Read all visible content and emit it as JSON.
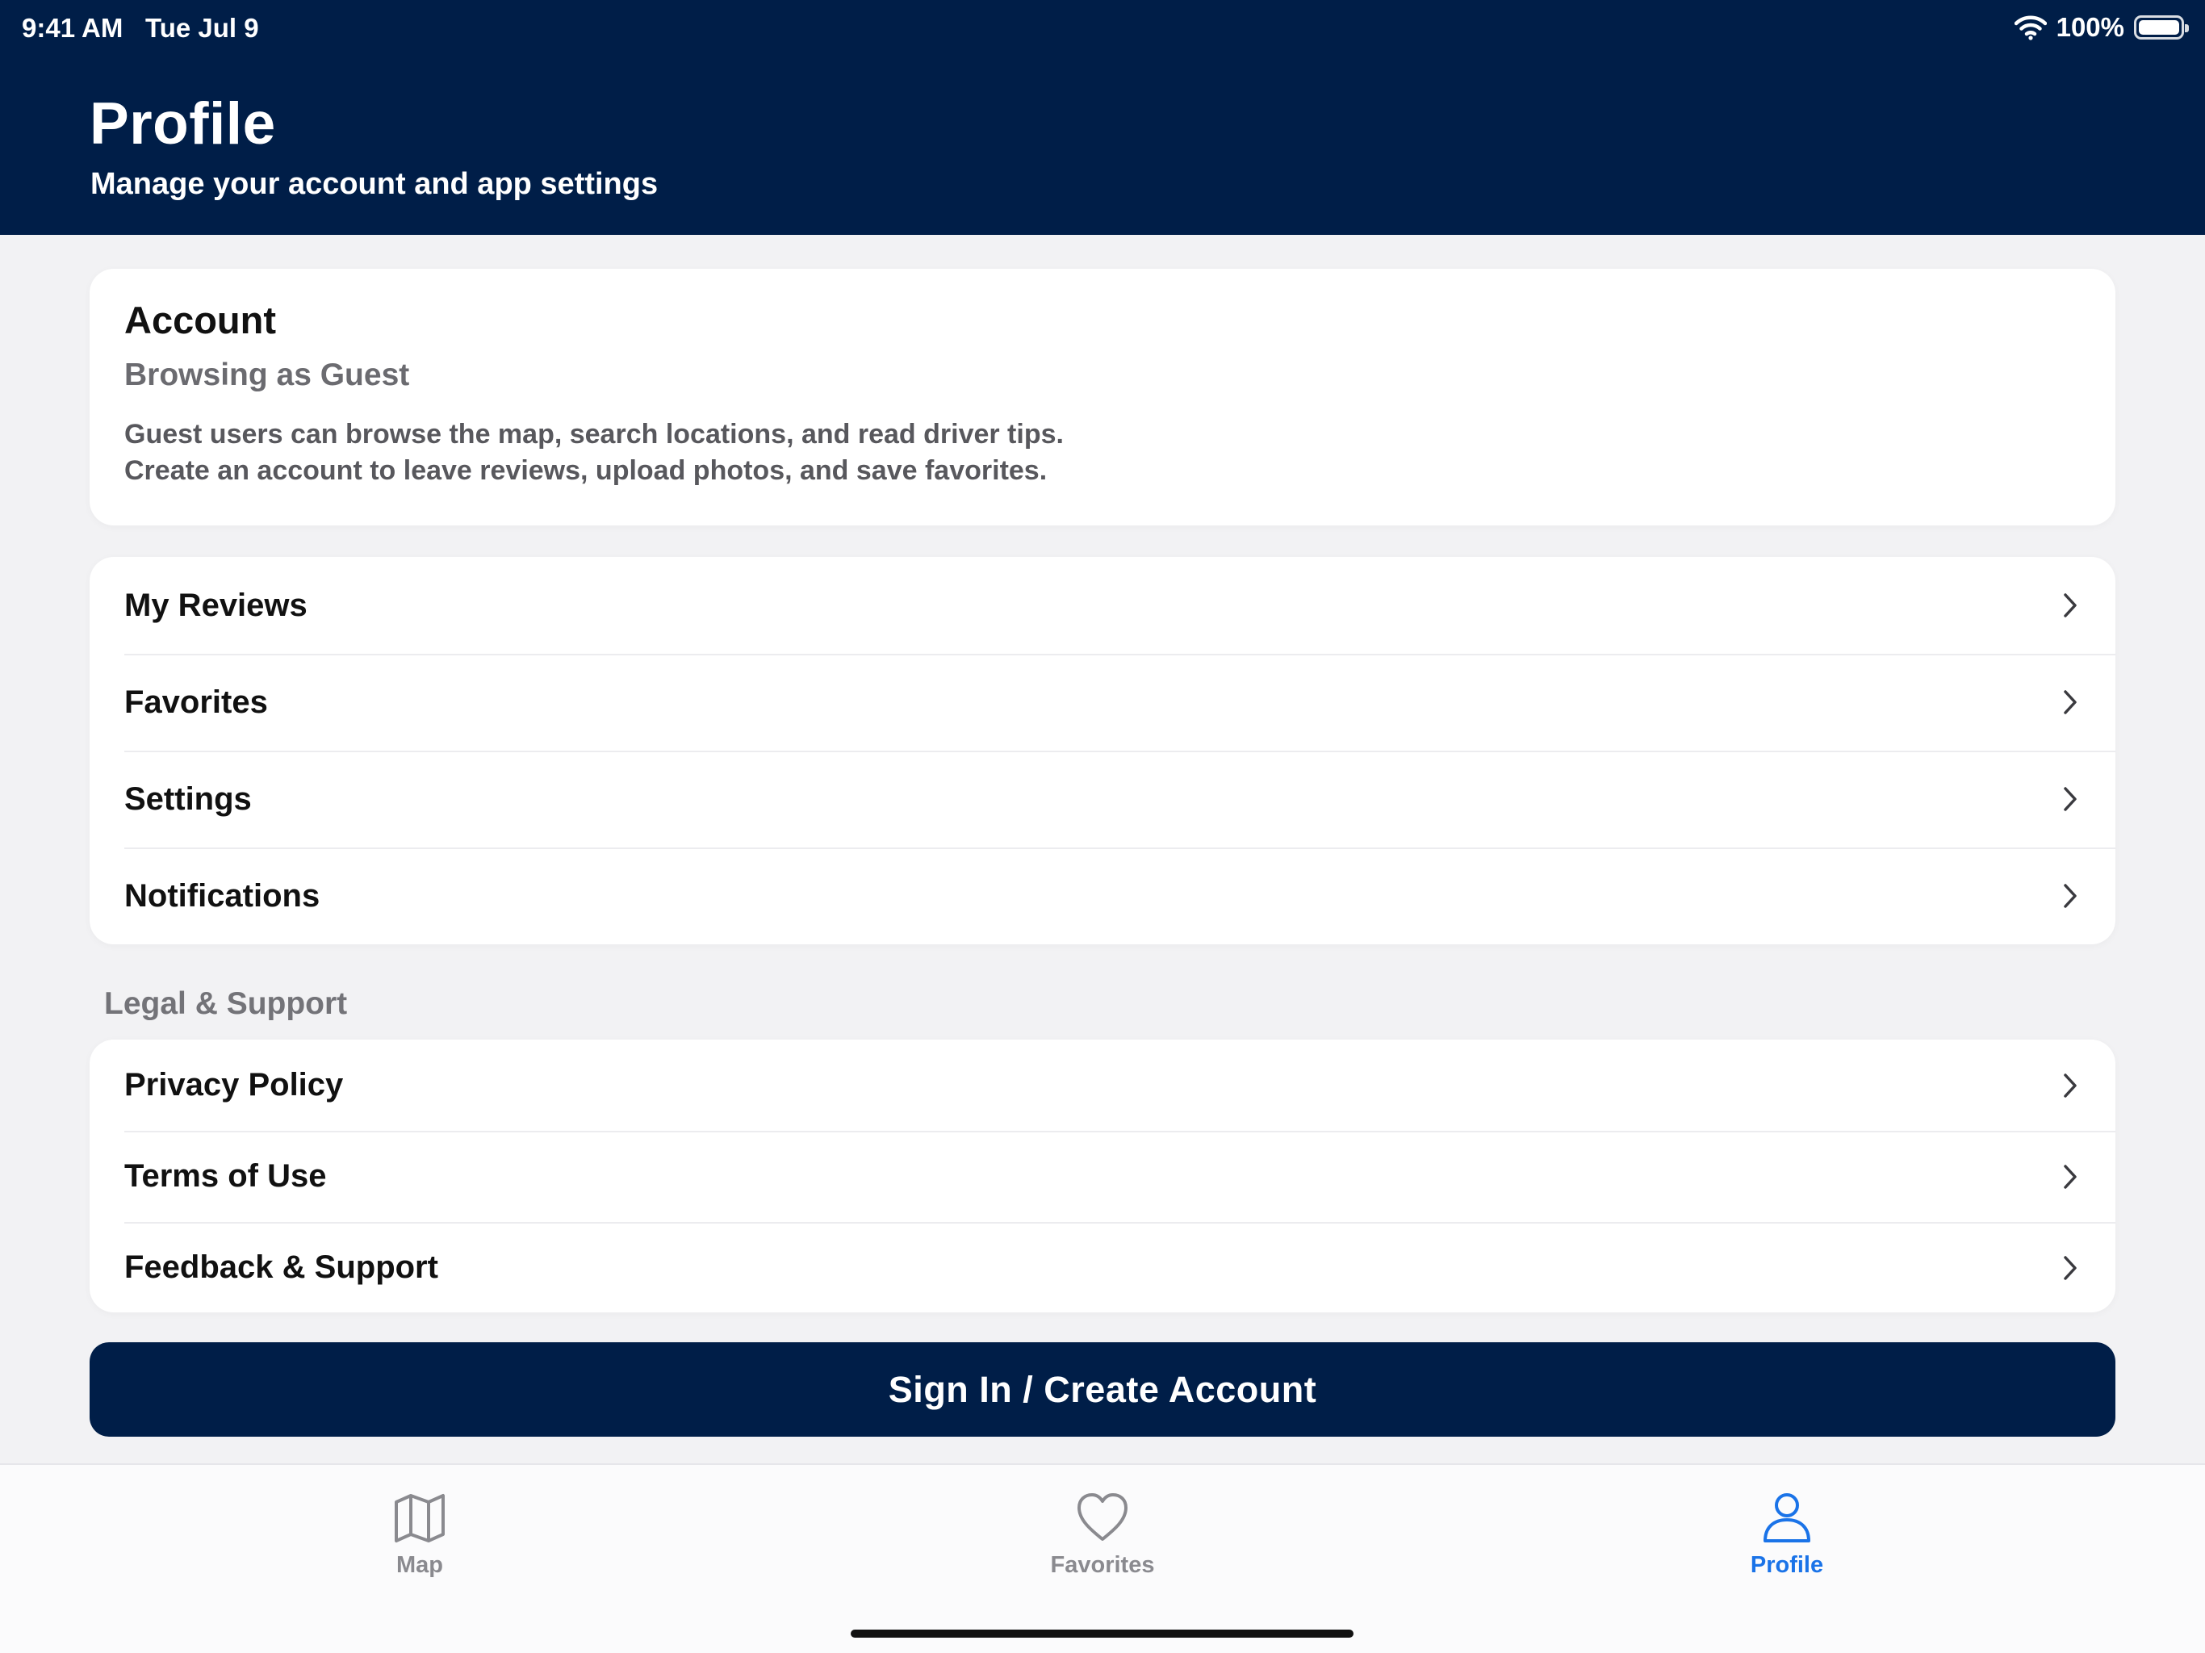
{
  "status_bar": {
    "time": "9:41 AM",
    "date": "Tue Jul 9",
    "battery_percent": "100%",
    "battery_level": 1.0,
    "icons": [
      "wifi-icon",
      "battery-icon"
    ]
  },
  "header": {
    "title": "Profile",
    "subtitle": "Manage your account and app settings",
    "background_color": "#001e48"
  },
  "account": {
    "title": "Account",
    "status": "Browsing as Guest",
    "description_line1": "Guest users can browse the map, search locations, and read driver tips.",
    "description_line2": "Create an account to leave reviews, upload photos, and save favorites."
  },
  "menu": {
    "items": [
      {
        "label": "My Reviews",
        "icon": "chevron-right-icon"
      },
      {
        "label": "Favorites",
        "icon": "chevron-right-icon"
      },
      {
        "label": "Settings",
        "icon": "chevron-right-icon"
      },
      {
        "label": "Notifications",
        "icon": "chevron-right-icon"
      }
    ]
  },
  "legal": {
    "section_title": "Legal & Support",
    "items": [
      {
        "label": "Privacy Policy",
        "icon": "chevron-right-icon"
      },
      {
        "label": "Terms of Use",
        "icon": "chevron-right-icon"
      },
      {
        "label": "Feedback & Support",
        "icon": "chevron-right-icon"
      }
    ]
  },
  "signin_button": {
    "label": "Sign In / Create Account",
    "color": "#001e48"
  },
  "tab_bar": {
    "tabs": [
      {
        "label": "Map",
        "icon": "map-icon",
        "selected": false
      },
      {
        "label": "Favorites",
        "icon": "heart-icon",
        "selected": false
      },
      {
        "label": "Profile",
        "icon": "person-icon",
        "selected": true
      }
    ],
    "active_color": "#1a73e8",
    "inactive_color": "#8a8a8f"
  }
}
